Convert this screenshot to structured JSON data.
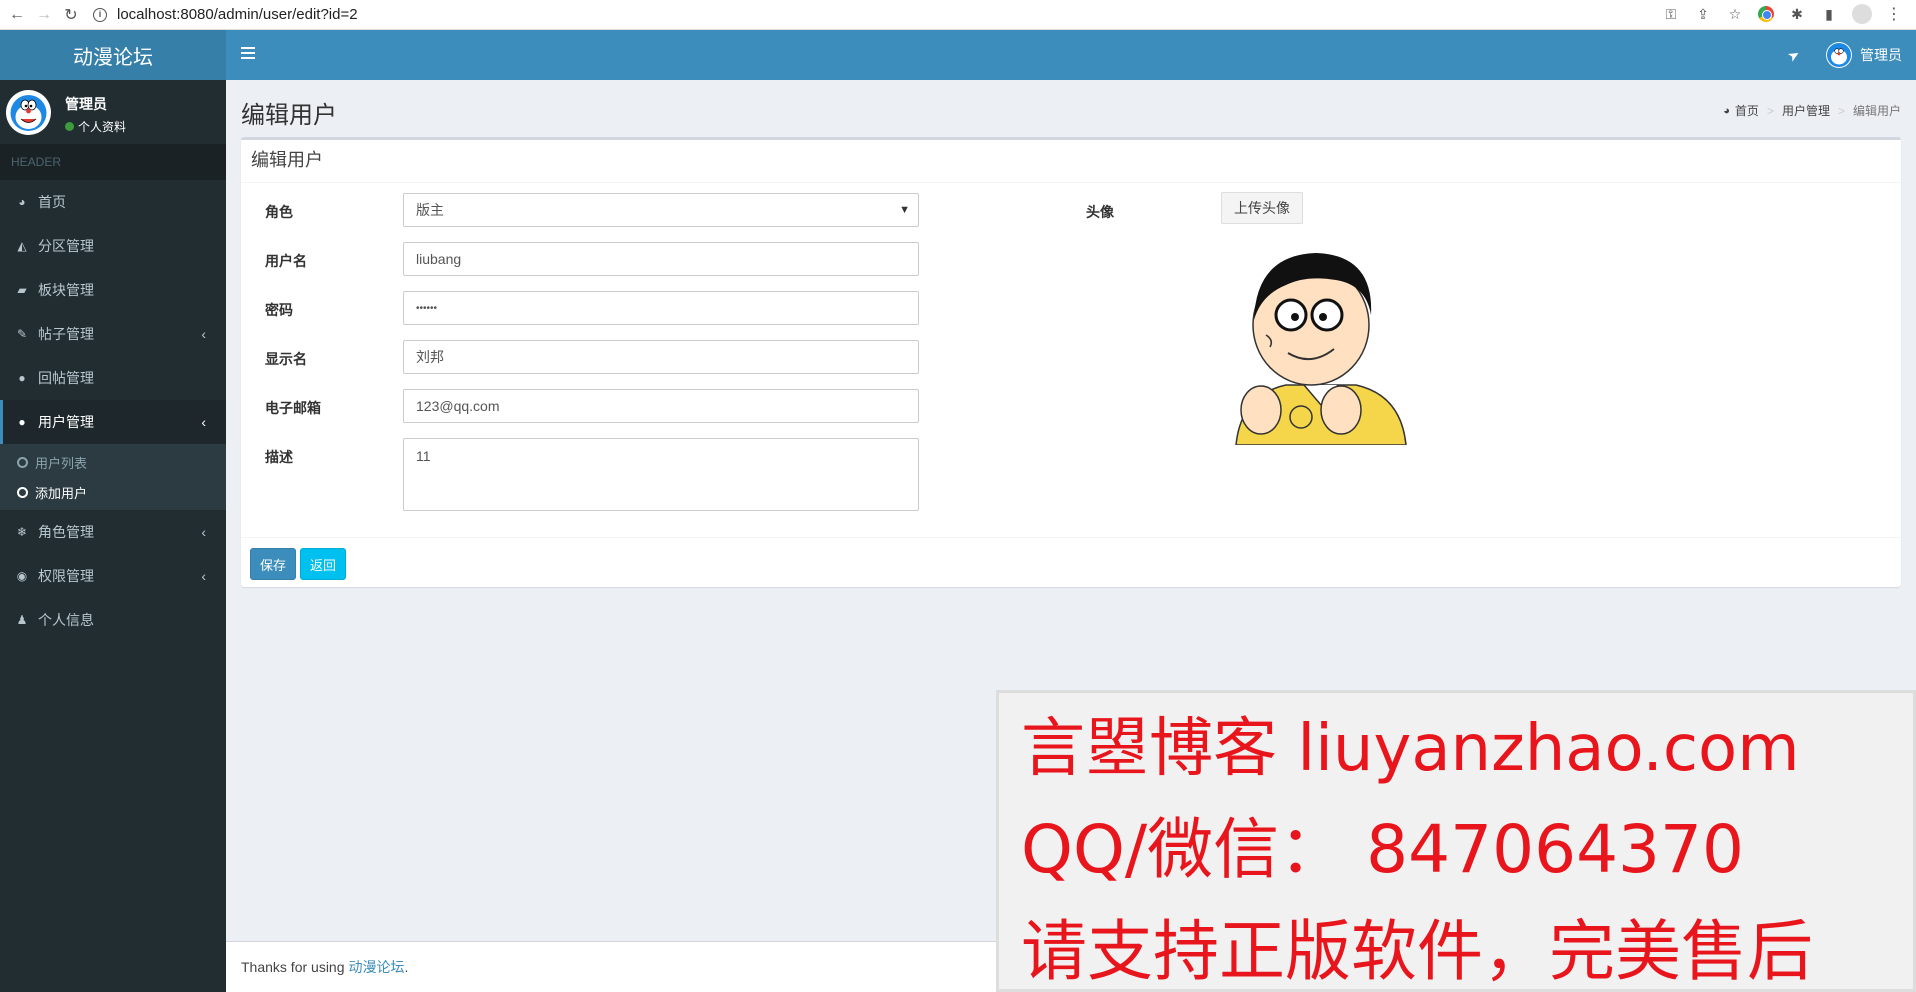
{
  "browser": {
    "url": "localhost:8080/admin/user/edit?id=2"
  },
  "app": {
    "logo": "动漫论坛",
    "top_username": "管理员"
  },
  "sidebar": {
    "user_name": "管理员",
    "user_status": "个人资料",
    "header": "HEADER",
    "items": [
      {
        "label": "首页",
        "icon": "dashboard-icon"
      },
      {
        "label": "分区管理",
        "icon": "area-chart-icon"
      },
      {
        "label": "板块管理",
        "icon": "book-icon"
      },
      {
        "label": "帖子管理",
        "icon": "paint-brush-icon"
      },
      {
        "label": "回帖管理",
        "icon": "comments-icon"
      },
      {
        "label": "用户管理",
        "icon": "users-icon"
      },
      {
        "label": "角色管理",
        "icon": "snowflake-icon"
      },
      {
        "label": "权限管理",
        "icon": "podcast-icon"
      },
      {
        "label": "个人信息",
        "icon": "user-icon"
      }
    ],
    "sub_items": [
      {
        "label": "用户列表"
      },
      {
        "label": "添加用户"
      }
    ]
  },
  "page": {
    "title": "编辑用户",
    "breadcrumb": [
      "首页",
      "用户管理",
      "编辑用户"
    ]
  },
  "form": {
    "box_title": "编辑用户",
    "role_label": "角色",
    "role_value": "版主",
    "username_label": "用户名",
    "username_value": "liubang",
    "password_label": "密码",
    "password_value": "••••••",
    "display_label": "显示名",
    "display_value": "刘邦",
    "email_label": "电子邮箱",
    "email_value": "123@qq.com",
    "desc_label": "描述",
    "desc_value": "11",
    "avatar_label": "头像",
    "upload_label": "上传头像",
    "save_label": "保存",
    "back_label": "返回"
  },
  "footer": {
    "text": "Thanks for using",
    "link": "动漫论坛",
    "suffix": "."
  },
  "watermark": {
    "line1": "言曌博客 liuyanzhao.com",
    "line2": "QQ/微信： 847064370",
    "line3": "请支持正版软件，完美售后"
  },
  "colors": {
    "header_bg": "#3c8dbc",
    "logo_bg": "#367fa9",
    "sidebar_bg": "#222d32",
    "content_bg": "#ecf0f5",
    "watermark_text": "#e8161c"
  }
}
